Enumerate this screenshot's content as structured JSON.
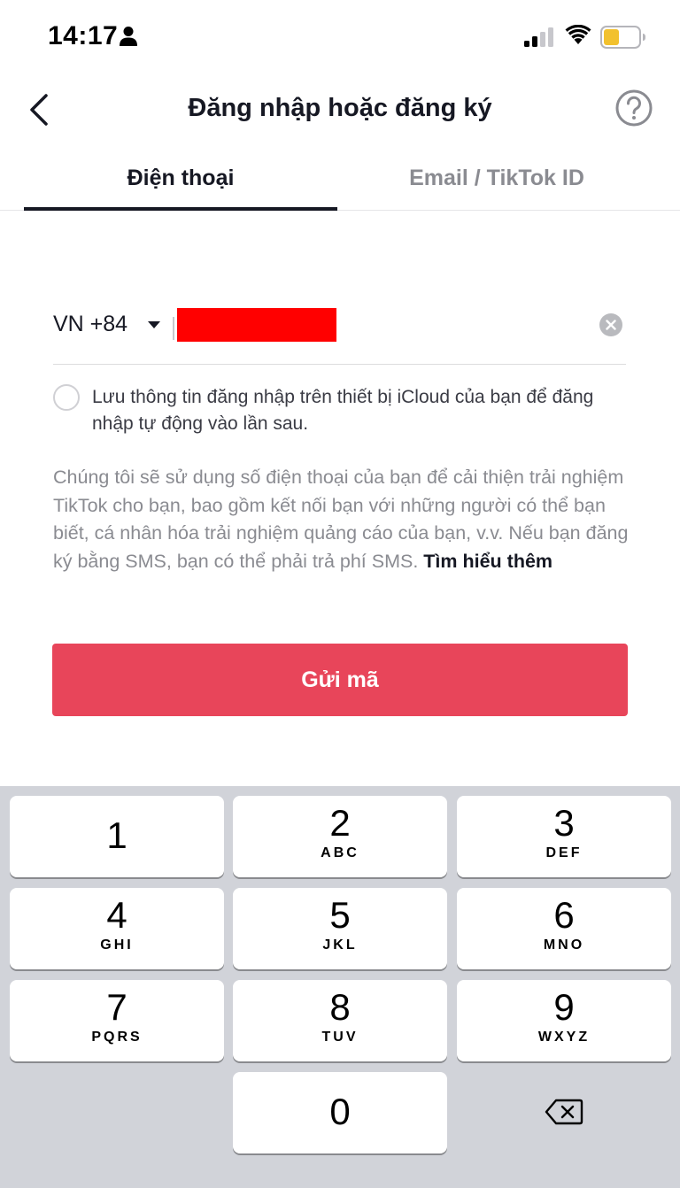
{
  "status_bar": {
    "time": "14:17",
    "icons": [
      "person-icon",
      "signal-icon",
      "wifi-icon",
      "battery-icon"
    ]
  },
  "header": {
    "title": "Đăng nhập hoặc đăng ký",
    "back_icon": "chevron-left-icon",
    "help_icon": "help-circle-icon"
  },
  "tabs": [
    {
      "label": "Điện thoại",
      "active": true
    },
    {
      "label": "Email / TikTok ID",
      "active": false
    }
  ],
  "phone": {
    "country_code": "VN +84",
    "value": ""
  },
  "remember": {
    "text": "Lưu thông tin đăng nhập trên thiết bị iCloud của bạn để đăng nhập tự động vào lần sau."
  },
  "info": {
    "text": "Chúng tôi sẽ sử dụng số điện thoại của bạn để cải thiện trải nghiệm TikTok cho bạn, bao gồm kết nối bạn với những người có thể bạn biết, cá nhân hóa trải nghiệm quảng cáo của bạn, v.v. Nếu bạn đăng ký bằng SMS, bạn có thể phải trả phí SMS. ",
    "link": "Tìm hiểu thêm"
  },
  "send_button": {
    "label": "Gửi mã"
  },
  "colors": {
    "accent": "#e8455a",
    "text": "#161823",
    "muted": "#8a8b91",
    "keyboard_bg": "#d1d3d9"
  },
  "keyboard": {
    "keys": [
      {
        "num": "1",
        "letters": ""
      },
      {
        "num": "2",
        "letters": "ABC"
      },
      {
        "num": "3",
        "letters": "DEF"
      },
      {
        "num": "4",
        "letters": "GHI"
      },
      {
        "num": "5",
        "letters": "JKL"
      },
      {
        "num": "6",
        "letters": "MNO"
      },
      {
        "num": "7",
        "letters": "PQRS"
      },
      {
        "num": "8",
        "letters": "TUV"
      },
      {
        "num": "9",
        "letters": "WXYZ"
      },
      {
        "num": "0",
        "letters": ""
      }
    ],
    "delete_icon": "backspace-icon"
  }
}
